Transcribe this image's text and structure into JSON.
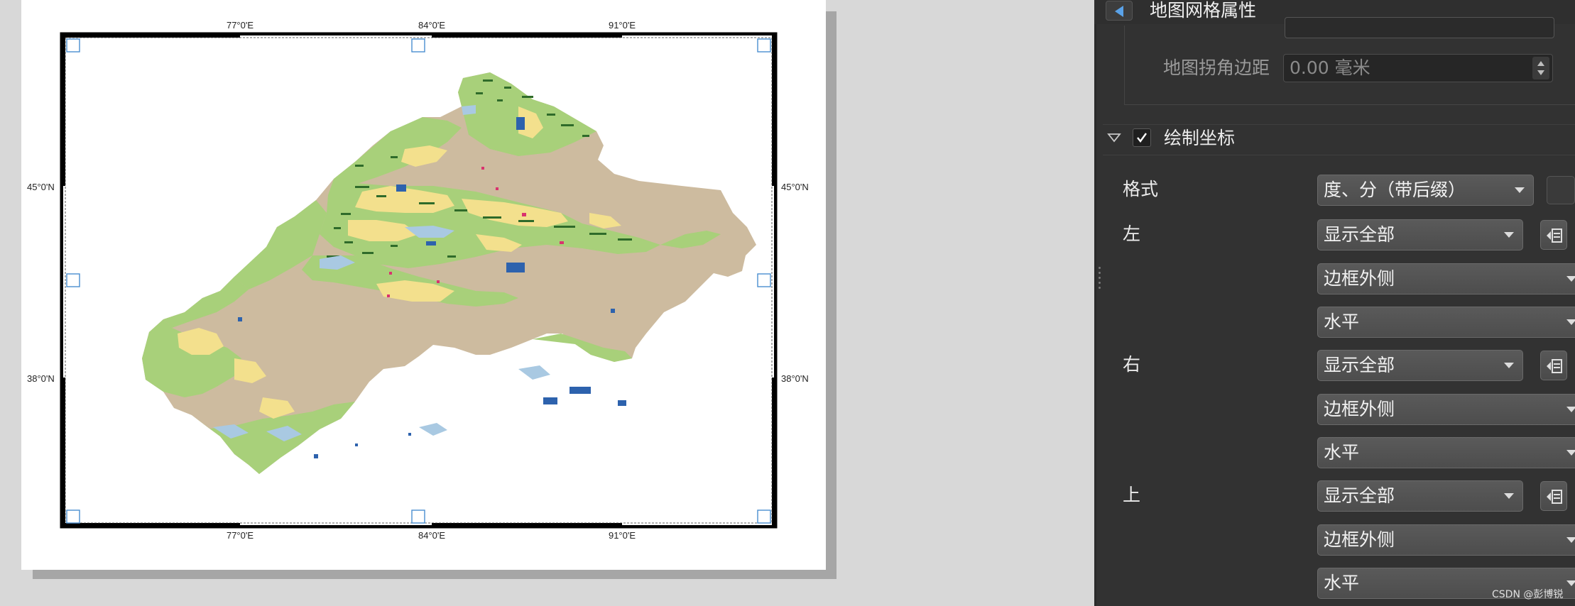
{
  "map": {
    "coords": {
      "top": [
        "77°0'E",
        "84°0'E",
        "91°0'E"
      ],
      "bottom": [
        "77°0'E",
        "84°0'E",
        "91°0'E"
      ],
      "left": [
        "45°0'N",
        "38°0'N"
      ],
      "right": [
        "45°0'N",
        "38°0'N"
      ]
    },
    "land_colors": {
      "desert": "#cdbb9f",
      "grassland": "#a8d07a",
      "cropland": "#f3e08d",
      "forest": "#2f6b2a",
      "water": "#2d62ad",
      "wetland": "#a9c9e2",
      "urban": "#d9336e"
    }
  },
  "panel": {
    "title": "地图网格属性",
    "corner_margin": {
      "label": "地图拐角边距",
      "value": "0.00 毫米"
    },
    "draw_coords": {
      "label": "绘制坐标",
      "checked": true
    },
    "format": {
      "label": "格式",
      "value": "度、分（带后缀）"
    },
    "sides": [
      {
        "label": "左",
        "display": "显示全部",
        "position": "边框外侧",
        "direction": "水平"
      },
      {
        "label": "右",
        "display": "显示全部",
        "position": "边框外侧",
        "direction": "水平"
      },
      {
        "label": "上",
        "display": "显示全部",
        "position": "边框外侧",
        "direction": "水平"
      }
    ],
    "watermark": "CSDN @彭博锐"
  }
}
